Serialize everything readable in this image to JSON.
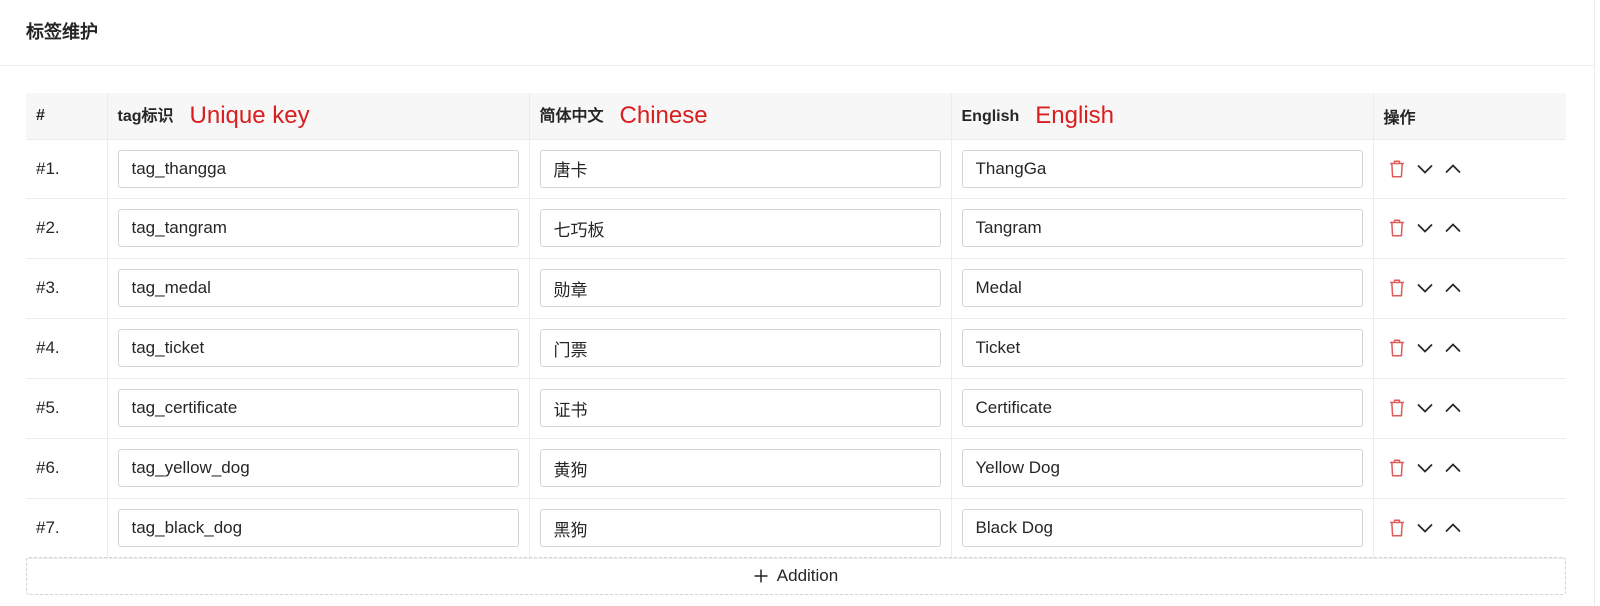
{
  "page_title": "标签维护",
  "table": {
    "headers": {
      "index": "#",
      "key": "tag标识",
      "key_note": "Unique key",
      "zh": "简体中文",
      "zh_note": "Chinese",
      "en": "English",
      "en_note": "English",
      "actions": "操作"
    },
    "rows": [
      {
        "index": "#1.",
        "key": "tag_thangga",
        "zh": "唐卡",
        "en": "ThangGa"
      },
      {
        "index": "#2.",
        "key": "tag_tangram",
        "zh": "七巧板",
        "en": "Tangram"
      },
      {
        "index": "#3.",
        "key": "tag_medal",
        "zh": "勋章",
        "en": "Medal"
      },
      {
        "index": "#4.",
        "key": "tag_ticket",
        "zh": "门票",
        "en": "Ticket"
      },
      {
        "index": "#5.",
        "key": "tag_certificate",
        "zh": "证书",
        "en": "Certificate"
      },
      {
        "index": "#6.",
        "key": "tag_yellow_dog",
        "zh": "黄狗",
        "en": "Yellow Dog"
      },
      {
        "index": "#7.",
        "key": "tag_black_dog",
        "zh": "黑狗",
        "en": "Black Dog"
      }
    ],
    "row_actions": [
      "trash-icon",
      "chevron-down-icon",
      "chevron-up-icon"
    ]
  },
  "add_button": {
    "label": "Addition",
    "icon": "plus-icon"
  },
  "colors": {
    "annotation": "#d81e1e",
    "delete": "#e05a5a",
    "border": "#d4d4d4"
  }
}
